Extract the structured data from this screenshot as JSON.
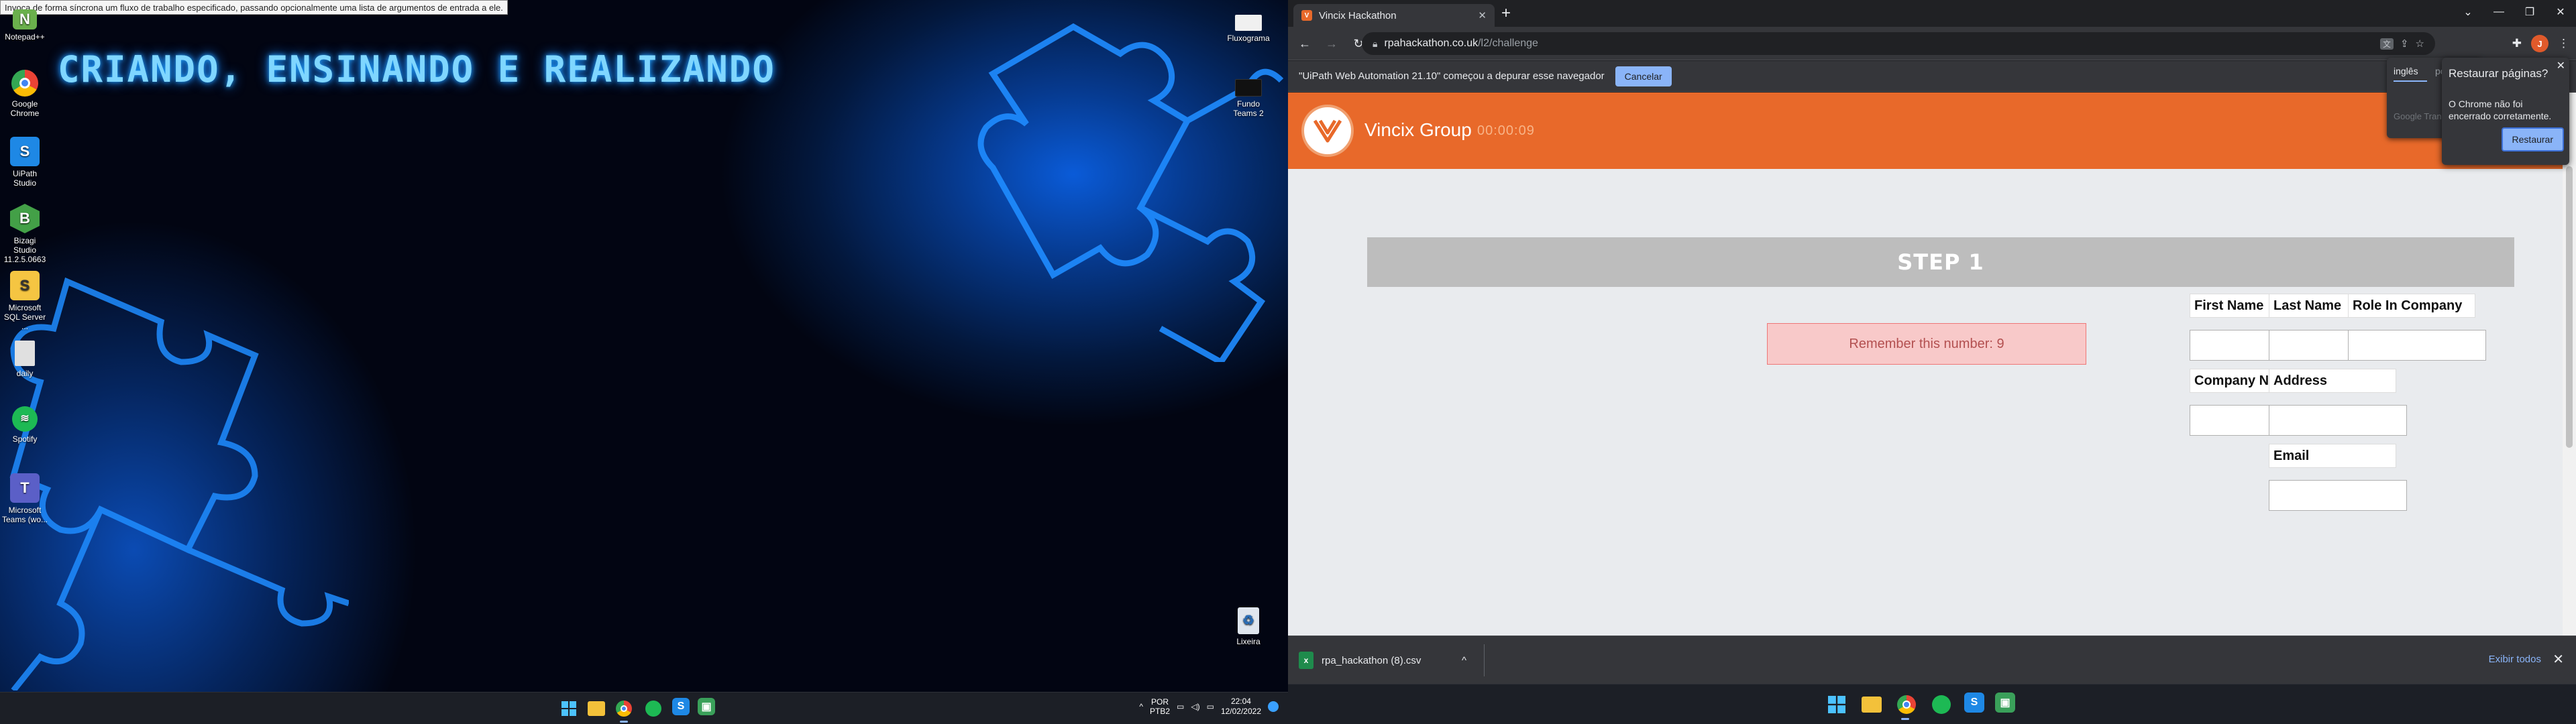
{
  "left_screen": {
    "tooltip": "Invoca de forma síncrona um fluxo de trabalho especificado, passando opcionalmente uma lista de argumentos de entrada a ele.",
    "wallpaper_title": "CRIANDO, ENSINANDO E REALIZANDO",
    "desktop_icons": [
      {
        "label": "Notepad++",
        "icon": "notepad-icon",
        "color": "#6ab04c"
      },
      {
        "label": "Google Chrome",
        "icon": "chrome-icon",
        "color": "#e8692a"
      },
      {
        "label": "UiPath Studio",
        "icon": "uipath-icon",
        "color": "#1e88e5"
      },
      {
        "label": "Bizagi Studio 11.2.5.0663",
        "icon": "bizagi-icon",
        "color": "#43a047"
      },
      {
        "label": "Microsoft SQL Server ...",
        "icon": "sql-server-icon",
        "color": "#f5c542"
      },
      {
        "label": "daily",
        "icon": "file-icon",
        "color": "#e0e0e0"
      },
      {
        "label": "Spotify",
        "icon": "spotify-icon",
        "color": "#1db954"
      },
      {
        "label": "Microsoft Teams (wo...",
        "icon": "teams-icon",
        "color": "#5b5fc7"
      }
    ],
    "right_icons": [
      {
        "label": "Fluxograma",
        "icon": "fluxograma-icon"
      },
      {
        "label": "Fundo Teams 2",
        "icon": "image-icon"
      },
      {
        "label": "Lixeira",
        "icon": "recycle-bin-icon"
      }
    ],
    "taskbar": {
      "lang_top": "POR",
      "lang_bottom": "PTB2",
      "time": "22:04",
      "date": "12/02/2022"
    }
  },
  "browser": {
    "tab_title": "Vincix Hackathon",
    "url_host": "rpahackathon.co.uk",
    "url_path": "/l2/challenge",
    "infobar_text": "\"UiPath Web Automation 21.10\" começou a depurar esse navegador",
    "cancel_label": "Cancelar",
    "profile_initial": "J"
  },
  "page": {
    "site_name": "Vincix Group",
    "timer": "00:00:09",
    "step_title": "STEP 1",
    "remember": "Remember this number: 9",
    "fields": [
      {
        "label": "First Name"
      },
      {
        "label": "Last Name"
      },
      {
        "label": "Role In Company"
      },
      {
        "label": "Company Name"
      },
      {
        "label": "Address"
      },
      {
        "label": "Email"
      }
    ]
  },
  "translate_popup": {
    "lang_active": "inglês",
    "lang_other": "po",
    "footer": "Google Translate"
  },
  "restore_popup": {
    "title": "Restaurar páginas?",
    "body": "O Chrome não foi encerrado corretamente.",
    "button": "Restaurar"
  },
  "downloads": {
    "file": "rpa_hackathon (8).csv",
    "show_all": "Exibir todos"
  }
}
